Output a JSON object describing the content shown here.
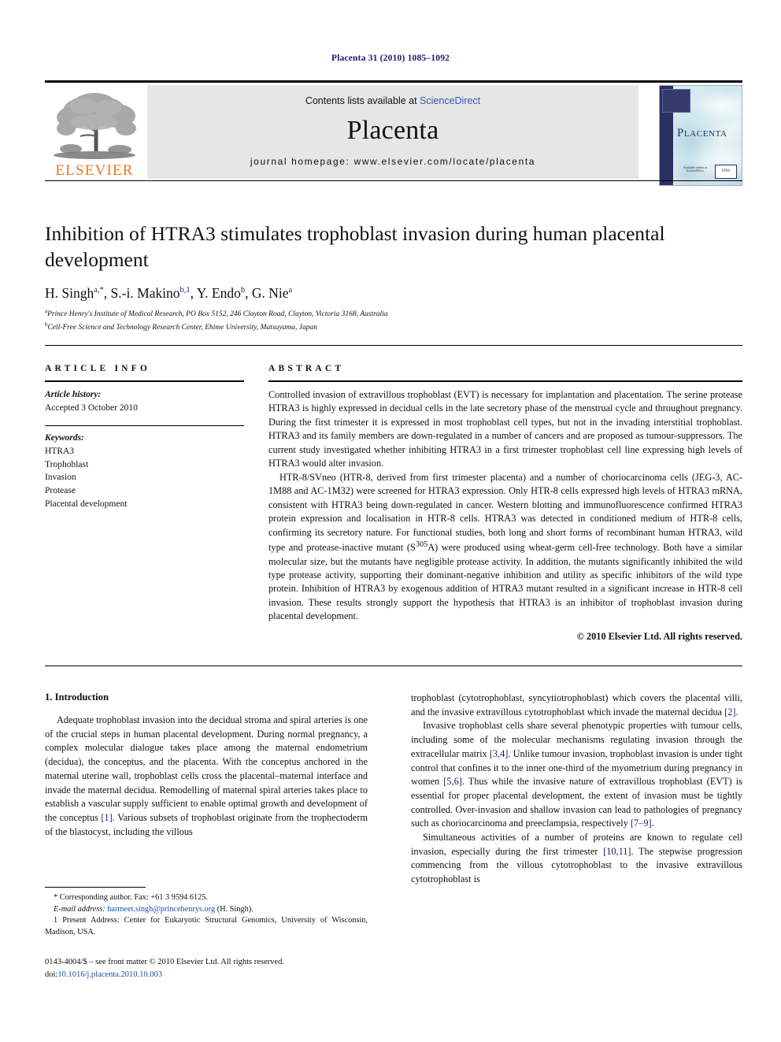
{
  "running_head": "Placenta 31 (2010) 1085–1092",
  "masthead": {
    "contents_prefix": "Contents lists available at ",
    "sciencedirect": "ScienceDirect",
    "journal_name": "Placenta",
    "homepage": "journal homepage: www.elsevier.com/locate/placenta",
    "publisher_logo_text": "ELSEVIER",
    "cover_title": "Placenta",
    "cover_badge_left": "Available online at ScienceDirect",
    "cover_badge_right": "IFPA"
  },
  "article": {
    "title": "Inhibition of HTRA3 stimulates trophoblast invasion during human placental development",
    "authors": [
      {
        "name": "H. Singh",
        "sup": "a,*"
      },
      {
        "name": "S.-i. Makino",
        "sup": "b,1"
      },
      {
        "name": "Y. Endo",
        "sup": "b"
      },
      {
        "name": "G. Nie",
        "sup": "a"
      }
    ],
    "affiliations": [
      {
        "marker": "a",
        "text": "Prince Henry's Institute of Medical Research, PO Box 5152, 246 Clayton Road, Clayton, Victoria 3168, Australia"
      },
      {
        "marker": "b",
        "text": "Cell-Free Science and Technology Research Center, Ehime University, Matsuyama, Japan"
      }
    ]
  },
  "article_info": {
    "heading": "ARTICLE INFO",
    "history_label": "Article history:",
    "history_value": "Accepted 3 October 2010",
    "keywords_label": "Keywords:",
    "keywords": [
      "HTRA3",
      "Trophoblast",
      "Invasion",
      "Protease",
      "Placental development"
    ]
  },
  "abstract": {
    "heading": "ABSTRACT",
    "paragraphs": [
      "Controlled invasion of extravillous trophoblast (EVT) is necessary for implantation and placentation. The serine protease HTRA3 is highly expressed in decidual cells in the late secretory phase of the menstrual cycle and throughout pregnancy. During the first trimester it is expressed in most trophoblast cell types, but not in the invading interstitial trophoblast. HTRA3 and its family members are down-regulated in a number of cancers and are proposed as tumour-suppressors. The current study investigated whether inhibiting HTRA3 in a first trimester trophoblast cell line expressing high levels of HTRA3 would alter invasion.",
      "HTR-8/SVneo (HTR-8, derived from first trimester placenta) and a number of choriocarcinoma cells (JEG-3, AC-1M88 and AC-1M32) were screened for HTRA3 expression. Only HTR-8 cells expressed high levels of HTRA3 mRNA, consistent with HTRA3 being down-regulated in cancer. Western blotting and immunofluorescence confirmed HTRA3 protein expression and localisation in HTR-8 cells. HTRA3 was detected in conditioned medium of HTR-8 cells, confirming its secretory nature. For functional studies, both long and short forms of recombinant human HTRA3, wild type and protease-inactive mutant (S305A) were produced using wheat-germ cell-free technology. Both have a similar molecular size, but the mutants have negligible protease activity. In addition, the mutants significantly inhibited the wild type protease activity, supporting their dominant-negative inhibition and utility as specific inhibitors of the wild type protein. Inhibition of HTRA3 by exogenous addition of HTRA3 mutant resulted in a significant increase in HTR-8 cell invasion. These results strongly support the hypothesis that HTRA3 is an inhibitor of trophoblast invasion during placental development."
    ],
    "mutant_base": "(S",
    "mutant_sup": "305",
    "mutant_tail": "A)",
    "copyright": "© 2010 Elsevier Ltd. All rights reserved."
  },
  "introduction": {
    "heading": "1. Introduction",
    "left_paragraphs": [
      "Adequate trophoblast invasion into the decidual stroma and spiral arteries is one of the crucial steps in human placental development. During normal pregnancy, a complex molecular dialogue takes place among the maternal endometrium (decidua), the conceptus, and the placenta. With the conceptus anchored in the maternal uterine wall, trophoblast cells cross the placental–maternal interface and invade the maternal decidua. Remodelling of maternal spiral arteries takes place to establish a vascular supply sufficient to enable optimal growth and development of the conceptus [1]. Various subsets of trophoblast originate from the trophectoderm of the blastocyst, including the villous"
    ],
    "right_paragraphs": [
      "trophoblast (cytotrophoblast, syncytiotrophoblast) which covers the placental villi, and the invasive extravillous cytotrophoblast which invade the maternal decidua [2].",
      "Invasive trophoblast cells share several phenotypic properties with tumour cells, including some of the molecular mechanisms regulating invasion through the extracellular matrix [3,4]. Unlike tumour invasion, trophoblast invasion is under tight control that confines it to the inner one-third of the myometrium during pregnancy in women [5,6]. Thus while the invasive nature of extravillous trophoblast (EVT) is essential for proper placental development, the extent of invasion must be tightly controlled. Over-invasion and shallow invasion can lead to pathologies of pregnancy such as choriocarcinoma and preeclampsia, respectively [7–9].",
      "Simultaneous activities of a number of proteins are known to regulate cell invasion, especially during the first trimester [10,11]. The stepwise progression commencing from the villous cytotrophoblast to the invasive extravillous cytotrophoblast is"
    ]
  },
  "footnotes": {
    "corresponding": "* Corresponding author. Fax: +61 3 9594 6125.",
    "email_label": "E-mail address:",
    "email": "harmeet.singh@princehenrys.org",
    "email_suffix": "(H. Singh).",
    "present_address": "1 Present Address: Center for Eukaryotic Structural Genomics, University of Wisconsin, Madison, USA."
  },
  "issn": {
    "line1": "0143-4004/$ – see front matter © 2010 Elsevier Ltd. All rights reserved.",
    "doi_label": "doi:",
    "doi_value": "10.1016/j.placenta.2010.10.003"
  },
  "colors": {
    "link_blue": "#1a4f9c",
    "ref_navy": "#1a1a6e",
    "elsevier_orange": "#E87722",
    "band_grey": "#e6e6e6"
  }
}
